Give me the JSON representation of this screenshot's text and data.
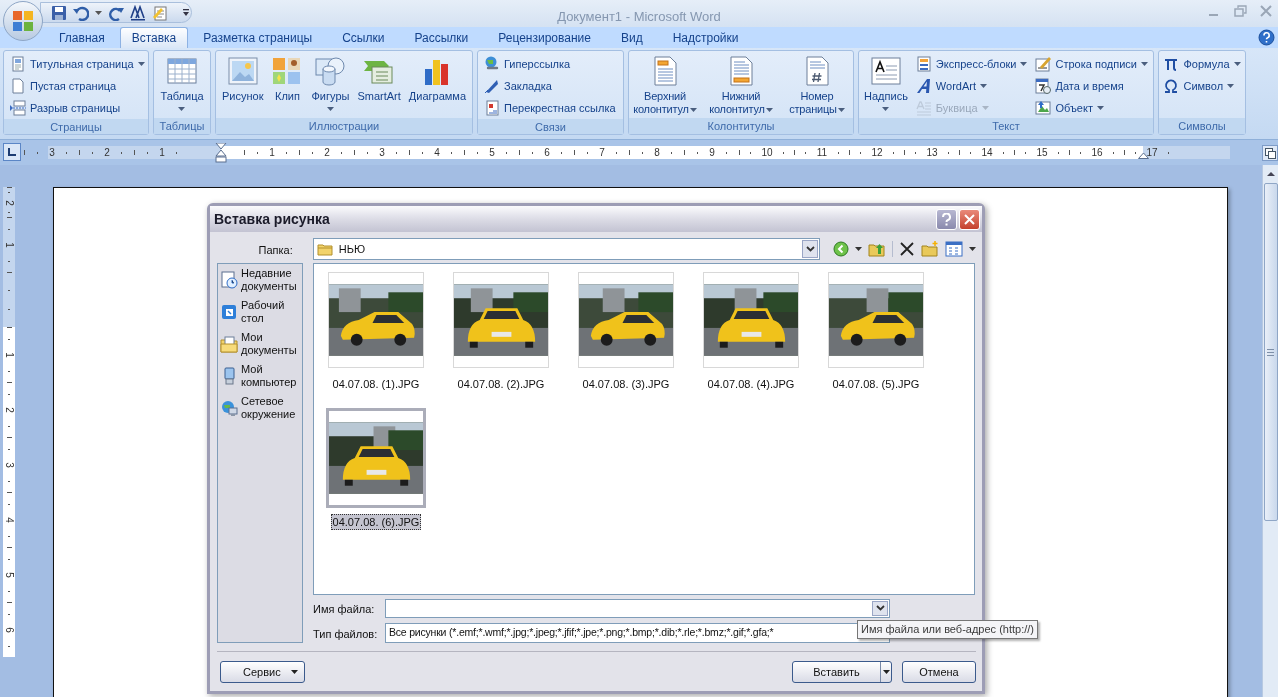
{
  "window": {
    "title": "Документ1 - Microsoft Word"
  },
  "ribbon": {
    "tabs": [
      {
        "label": "Главная",
        "selected": false
      },
      {
        "label": "Вставка",
        "selected": true
      },
      {
        "label": "Разметка страницы",
        "selected": false
      },
      {
        "label": "Ссылки",
        "selected": false
      },
      {
        "label": "Рассылки",
        "selected": false
      },
      {
        "label": "Рецензирование",
        "selected": false
      },
      {
        "label": "Вид",
        "selected": false
      },
      {
        "label": "Надстройки",
        "selected": false
      }
    ],
    "groups": [
      {
        "label": "Страницы",
        "items": [
          {
            "kind": "small",
            "label": "Титульная страница",
            "dropdown": true
          },
          {
            "kind": "small",
            "label": "Пустая страница"
          },
          {
            "kind": "small",
            "label": "Разрыв страницы"
          }
        ]
      },
      {
        "label": "Таблицы",
        "items": [
          {
            "kind": "large-menu",
            "label": "Таблица",
            "dropdown": true
          }
        ]
      },
      {
        "label": "Иллюстрации",
        "items": [
          {
            "kind": "large",
            "label": "Рисунок"
          },
          {
            "kind": "large",
            "label": "Клип"
          },
          {
            "kind": "large-menu",
            "label": "Фигуры",
            "dropdown": true
          },
          {
            "kind": "large",
            "label": "SmartArt"
          },
          {
            "kind": "large",
            "label": "Диаграмма"
          }
        ]
      },
      {
        "label": "Связи",
        "items": [
          {
            "kind": "small",
            "label": "Гиперссылка"
          },
          {
            "kind": "small",
            "label": "Закладка"
          },
          {
            "kind": "small",
            "label": "Перекрестная ссылка"
          }
        ]
      },
      {
        "label": "Колонтитулы",
        "items": [
          {
            "kind": "large",
            "label": "Верхний колонтитул",
            "dropdown": true
          },
          {
            "kind": "large",
            "label": "Нижний колонтитул",
            "dropdown": true
          },
          {
            "kind": "large",
            "label": "Номер страницы",
            "dropdown": true
          }
        ]
      },
      {
        "label": "Текст",
        "items": [
          {
            "kind": "large-menu",
            "label": "Надпись",
            "dropdown": true
          },
          {
            "kind": "small",
            "label": "Экспресс-блоки",
            "dropdown": true
          },
          {
            "kind": "small",
            "label": "WordArt",
            "dropdown": true
          },
          {
            "kind": "small",
            "label": "Буквица",
            "dropdown": true,
            "disabled": true
          },
          {
            "kind": "small",
            "label": "Строка подписи",
            "dropdown": true
          },
          {
            "kind": "small",
            "label": "Дата и время"
          },
          {
            "kind": "small",
            "label": "Объект",
            "dropdown": true
          }
        ]
      },
      {
        "label": "Символы",
        "items": [
          {
            "kind": "small",
            "label": "Формула",
            "dropdown": true
          },
          {
            "kind": "small",
            "label": "Символ",
            "dropdown": true
          }
        ]
      }
    ]
  },
  "ruler": {
    "left_numbers": [
      "3",
      "2",
      "1"
    ],
    "numbers": [
      "1",
      "2",
      "3",
      "4",
      "5",
      "6",
      "7",
      "8",
      "9",
      "10",
      "11",
      "12",
      "13",
      "14",
      "15",
      "16",
      "17"
    ]
  },
  "vertical_ruler": {
    "top_numbers": [
      "2",
      "1"
    ],
    "numbers": [
      "1",
      "2",
      "3",
      "4",
      "5",
      "6"
    ]
  },
  "dialog": {
    "title": "Вставка рисунка",
    "folder_label": "Папка:",
    "folder": "НЬЮ",
    "places": [
      {
        "label": "Недавние документы"
      },
      {
        "label": "Рабочий стол"
      },
      {
        "label": "Мои документы"
      },
      {
        "label": "Мой компьютер"
      },
      {
        "label": "Сетевое окружение"
      }
    ],
    "files": [
      {
        "name": "04.07.08. (1).JPG",
        "selected": false
      },
      {
        "name": "04.07.08. (2).JPG",
        "selected": false
      },
      {
        "name": "04.07.08. (3).JPG",
        "selected": false
      },
      {
        "name": "04.07.08. (4).JPG",
        "selected": false
      },
      {
        "name": "04.07.08. (5).JPG",
        "selected": false
      },
      {
        "name": "04.07.08. (6).JPG",
        "selected": true
      }
    ],
    "file_name_label": "Имя файла:",
    "file_type_label": "Тип файлов:",
    "file_type": "Все рисунки (*.emf;*.wmf;*.jpg;*.jpeg;*.jfif;*.jpe;*.png;*.bmp;*.dib;*.rle;*.bmz;*.gif;*.gfa;*",
    "tooltip": "Имя файла или веб-адрес (http://)",
    "buttons": [
      {
        "label": "Сервис",
        "kind": "menu"
      },
      {
        "label": "Вставить",
        "kind": "split"
      },
      {
        "label": "Отмена",
        "kind": "plain"
      }
    ]
  }
}
